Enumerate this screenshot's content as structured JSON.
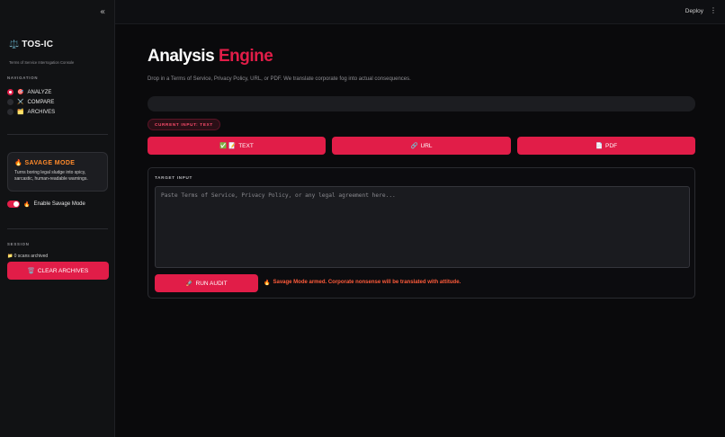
{
  "sidebar": {
    "collapse_icon": "«",
    "brand": {
      "icon": "⚖️",
      "title": "TOS-IC",
      "subtitle": "Terms of Service Interrogation Console"
    },
    "navigation_label": "NAVIGATION",
    "nav_items": [
      {
        "icon": "🎯",
        "label": "ANALYZE",
        "selected": true
      },
      {
        "icon": "⚔️",
        "label": "COMPARE",
        "selected": false
      },
      {
        "icon": "🗂️",
        "label": "ARCHIVES",
        "selected": false
      }
    ],
    "savage_card": {
      "icon": "🔥",
      "title": "SAVAGE MODE",
      "description": "Turns boring legal sludge into spicy, sarcastic, human-readable warnings."
    },
    "savage_toggle": {
      "icon": "🔥",
      "label": "Enable Savage Mode",
      "enabled": true
    },
    "session_label": "SESSION",
    "scans": {
      "icon": "📁",
      "text": "0 scans archived"
    },
    "clear_button": {
      "icon": "🗑️",
      "label": "CLEAR ARCHIVES"
    }
  },
  "topbar": {
    "deploy_label": "Deploy",
    "menu_icon": "⋮"
  },
  "main": {
    "title_word1": "Analysis",
    "title_word2": "Engine",
    "subtitle": "Drop in a Terms of Service, Privacy Policy, URL, or PDF. We translate corporate fog into actual consequences.",
    "current_input_badge": "CURRENT INPUT: TEXT",
    "mode_buttons": [
      {
        "icon": "✅ 📝",
        "label": "TEXT"
      },
      {
        "icon": "🔗",
        "label": "URL"
      },
      {
        "icon": "📄",
        "label": "PDF"
      }
    ],
    "panel": {
      "label": "TARGET INPUT",
      "textarea_placeholder": "Paste Terms of Service, Privacy Policy, or any legal agreement here...",
      "run_button": {
        "icon": "🚀",
        "label": "RUN AUDIT"
      },
      "armed_message": {
        "icon": "🔥",
        "text": "Savage Mode armed. Corporate nonsense will be translated with attitude."
      }
    }
  },
  "colors": {
    "accent": "#e11d48",
    "savage_orange": "#ff8a2b",
    "background": "#0a0a0c",
    "sidebar": "#111214"
  }
}
